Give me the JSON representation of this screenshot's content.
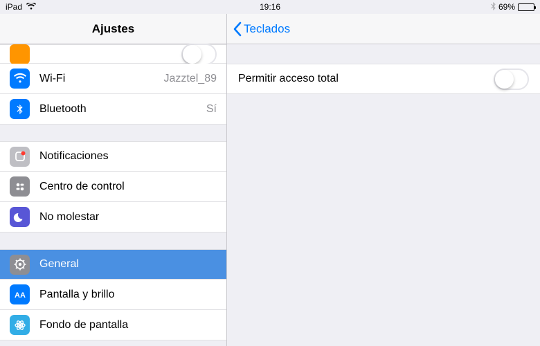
{
  "statusbar": {
    "device": "iPad",
    "time": "19:16",
    "battery_pct": "69%"
  },
  "sidebar": {
    "title": "Ajustes",
    "items": [
      {
        "label": "",
        "value": "",
        "iconcolor": "#ff9500",
        "partial": true,
        "toggle": true
      },
      {
        "label": "Wi-Fi",
        "value": "Jazztel_89",
        "iconcolor": "#007aff"
      },
      {
        "label": "Bluetooth",
        "value": "Sí",
        "iconcolor": "#007aff"
      }
    ],
    "group2": [
      {
        "label": "Notificaciones",
        "iconcolor": "#bfbfc4"
      },
      {
        "label": "Centro de control",
        "iconcolor": "#8e8e93"
      },
      {
        "label": "No molestar",
        "iconcolor": "#5856d6"
      }
    ],
    "group3": [
      {
        "label": "General",
        "iconcolor": "#8e8e93",
        "selected": true
      },
      {
        "label": "Pantalla y brillo",
        "iconcolor": "#007aff"
      },
      {
        "label": "Fondo de pantalla",
        "iconcolor": "#32ade6"
      }
    ]
  },
  "detail": {
    "back_label": "Teclados",
    "setting_label": "Permitir acceso total",
    "setting_on": false
  }
}
